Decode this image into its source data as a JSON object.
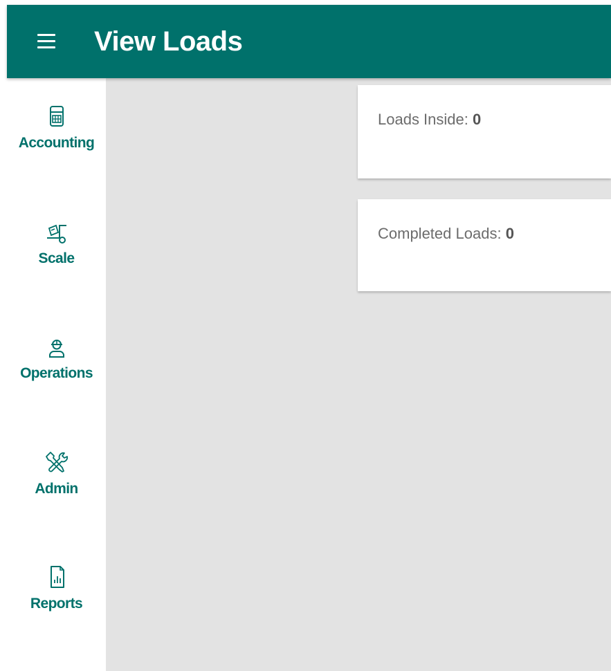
{
  "header": {
    "title": "View Loads",
    "menu_icon": "hamburger-menu-icon"
  },
  "sidebar": {
    "items": [
      {
        "label": "Accounting",
        "icon": "calculator-icon"
      },
      {
        "label": "Scale",
        "icon": "scale-cart-icon"
      },
      {
        "label": "Operations",
        "icon": "hard-hat-worker-icon"
      },
      {
        "label": "Admin",
        "icon": "wrench-screwdriver-icon"
      },
      {
        "label": "Reports",
        "icon": "report-chart-icon"
      }
    ]
  },
  "cards": {
    "loads_inside": {
      "label": "Loads Inside:",
      "value": "0"
    },
    "completed_loads": {
      "label": "Completed Loads:",
      "value": "0"
    }
  },
  "colors": {
    "primary": "#00716b",
    "content_background": "#e3e3e3",
    "card_background": "#ffffff",
    "card_text": "#6c6c6c"
  }
}
